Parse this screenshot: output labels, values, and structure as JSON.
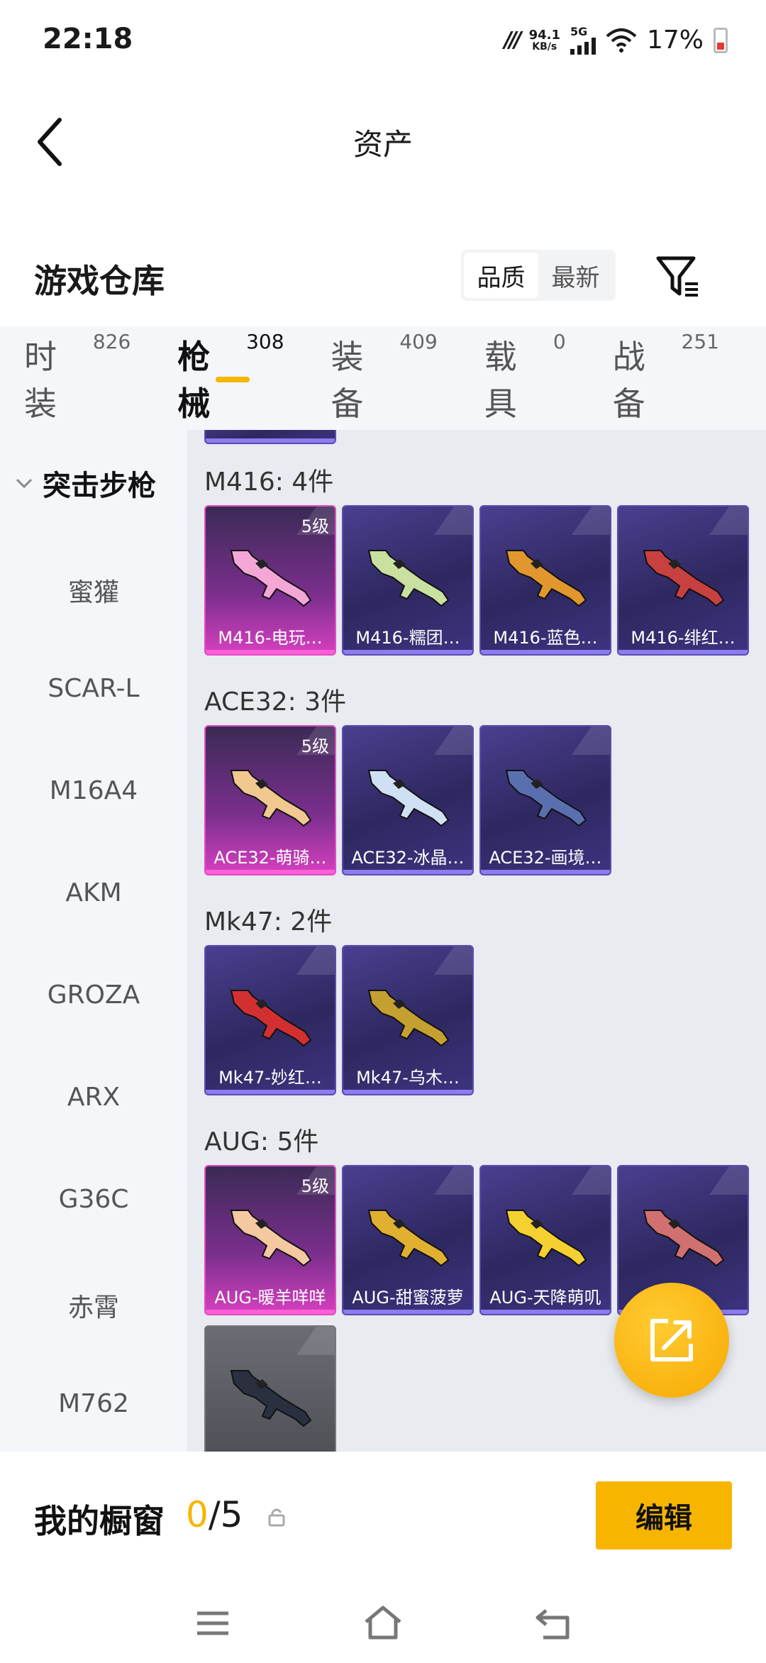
{
  "status": {
    "time": "22:18",
    "net_speed": "94.1",
    "net_unit": "KB/s",
    "network": "5G",
    "battery": "17%"
  },
  "header": {
    "title": "资产"
  },
  "warehouse": {
    "title": "游戏仓库",
    "sort": [
      "品质",
      "最新"
    ]
  },
  "category_tabs": [
    {
      "label": "时装",
      "count": "826"
    },
    {
      "label": "枪械",
      "count": "308"
    },
    {
      "label": "装备",
      "count": "409"
    },
    {
      "label": "载具",
      "count": "0"
    },
    {
      "label": "战备",
      "count": "251"
    }
  ],
  "side": {
    "header": "突击步枪",
    "items": [
      "蜜獾",
      "SCAR-L",
      "M16A4",
      "AKM",
      "GROZA",
      "ARX",
      "G36C",
      "赤霄",
      "M762"
    ]
  },
  "groups": [
    {
      "title": "M416: 4件",
      "cards": [
        {
          "name": "M416-电玩…",
          "tier": "5级",
          "rarity": "legend"
        },
        {
          "name": "M416-糯团…",
          "rarity": "epic"
        },
        {
          "name": "M416-蓝色…",
          "rarity": "epic"
        },
        {
          "name": "M416-绯红…",
          "rarity": "epic"
        }
      ]
    },
    {
      "title": "ACE32: 3件",
      "cards": [
        {
          "name": "ACE32-萌骑…",
          "tier": "5级",
          "rarity": "legend"
        },
        {
          "name": "ACE32-冰晶…",
          "rarity": "epic"
        },
        {
          "name": "ACE32-画境…",
          "rarity": "epic"
        }
      ]
    },
    {
      "title": "Mk47: 2件",
      "cards": [
        {
          "name": "Mk47-妙红…",
          "rarity": "epic"
        },
        {
          "name": "Mk47-乌木…",
          "rarity": "epic"
        }
      ]
    },
    {
      "title": "AUG: 5件",
      "cards": [
        {
          "name": "AUG-暖羊咩咩",
          "tier": "5级",
          "rarity": "legend"
        },
        {
          "name": "AUG-甜蜜菠萝",
          "rarity": "epic"
        },
        {
          "name": "AUG-天降萌叽",
          "rarity": "epic"
        },
        {
          "name": "…者",
          "rarity": "epic"
        },
        {
          "name": "",
          "rarity": "grey"
        }
      ]
    }
  ],
  "showcase": {
    "label": "我的橱窗",
    "current": "0",
    "total": "/5",
    "edit": "编辑"
  },
  "colors": {
    "accent": "#f7b500",
    "legend": "#d640bf",
    "epic": "#4a3f90"
  }
}
